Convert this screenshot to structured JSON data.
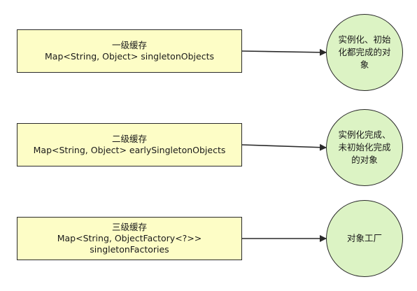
{
  "levels": [
    {
      "box_title": "一级缓存",
      "box_line2": "Map<String, Object> singletonObjects",
      "box_line3": "",
      "circle_text": "实例化、初始化都完成的对象"
    },
    {
      "box_title": "二级缓存",
      "box_line2": "Map<String, Object> earlySingletonObjects",
      "box_line3": "",
      "circle_text": "实例化完成、未初始化完成的对象"
    },
    {
      "box_title": "三级缓存",
      "box_line2": "Map<String, ObjectFactory<?>>",
      "box_line3": "singletonFactories",
      "circle_text": "对象工厂"
    }
  ],
  "colors": {
    "box_fill": "#fdfdc6",
    "circle_fill": "#dcf3c4",
    "stroke": "#2a2a2a"
  }
}
